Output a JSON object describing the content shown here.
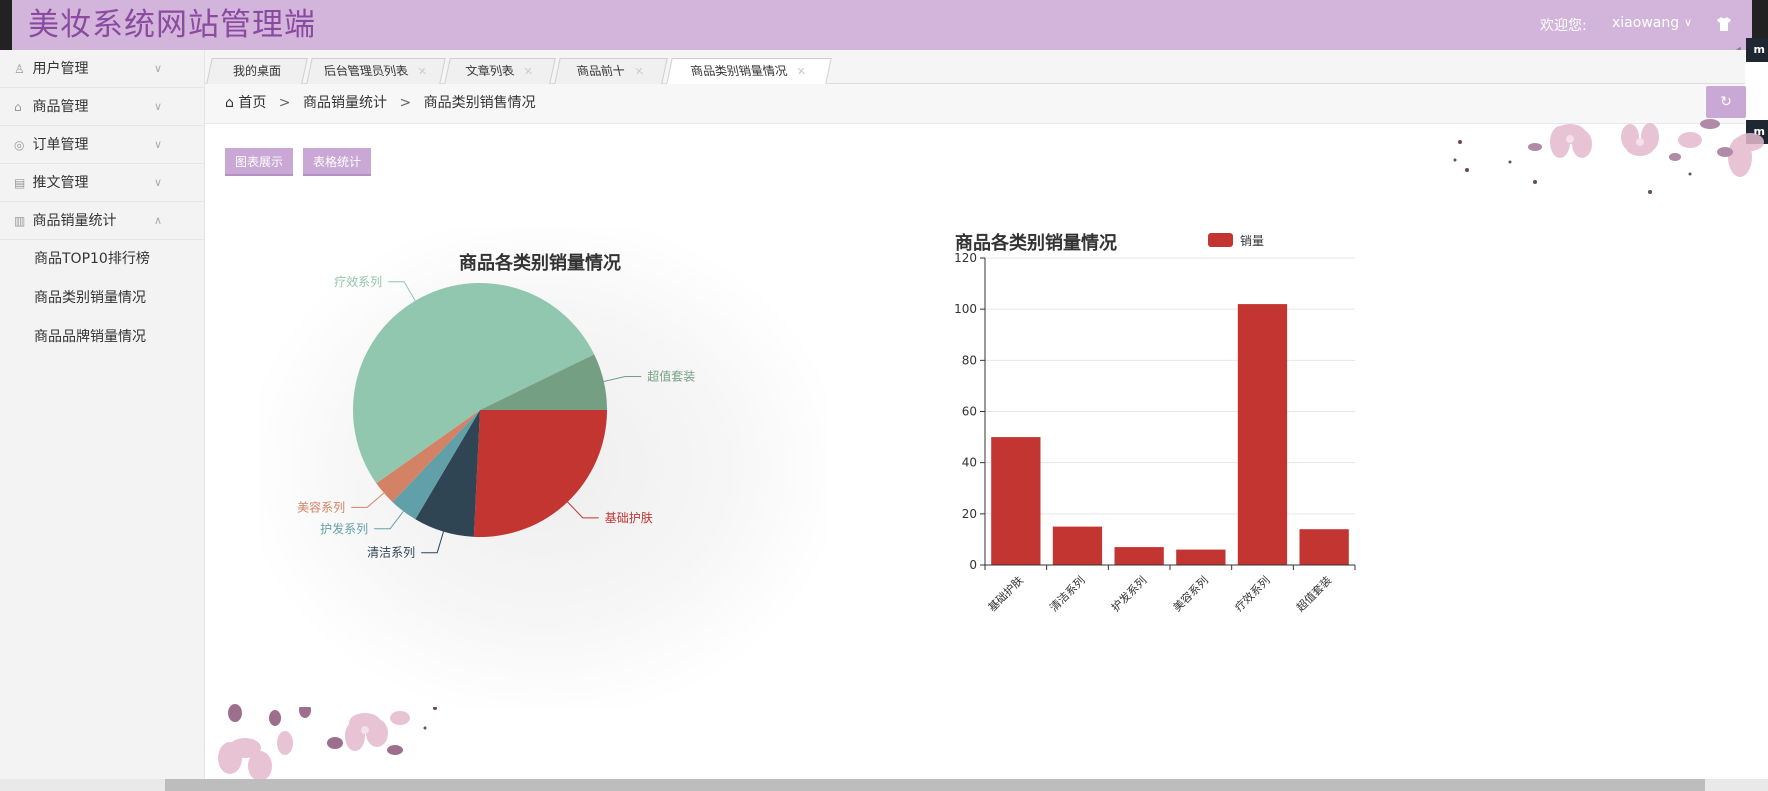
{
  "header": {
    "title": "美妆系统网站管理端",
    "welcome": "欢迎您:",
    "username": "xiaowang"
  },
  "sidebar": {
    "items": [
      {
        "label": "用户管理",
        "icon": "users-icon",
        "expanded": false
      },
      {
        "label": "商品管理",
        "icon": "bag-icon",
        "expanded": false
      },
      {
        "label": "订单管理",
        "icon": "lock-icon",
        "expanded": false
      },
      {
        "label": "推文管理",
        "icon": "doc-icon",
        "expanded": false
      },
      {
        "label": "商品销量统计",
        "icon": "chart-icon",
        "expanded": true,
        "children": [
          "商品TOP10排行榜",
          "商品类别销量情况",
          "商品品牌销量情况"
        ]
      }
    ]
  },
  "tabs": [
    {
      "label": "我的桌面",
      "closable": false,
      "active": false
    },
    {
      "label": "后台管理员列表",
      "closable": true,
      "active": false
    },
    {
      "label": "文章列表",
      "closable": true,
      "active": false
    },
    {
      "label": "商品前十",
      "closable": true,
      "active": false
    },
    {
      "label": "商品类别销量情况",
      "closable": true,
      "active": true
    }
  ],
  "breadcrumb": {
    "home": "首页",
    "level1": "商品销量统计",
    "level2": "商品类别销售情况",
    "separator": ">"
  },
  "buttons": {
    "chart_view": "图表展示",
    "table_view": "表格统计"
  },
  "colors": {
    "header_bg": "#d3b5dc",
    "title": "#8a4aa0",
    "accent": "#caa8d6",
    "bar": "#c23531"
  },
  "chart_data": [
    {
      "type": "pie",
      "title": "商品各类别销量情况",
      "slices": [
        {
          "label": "基础护肤",
          "value": 50,
          "color": "#c23531"
        },
        {
          "label": "清洁系列",
          "value": 15,
          "color": "#2f4554"
        },
        {
          "label": "护发系列",
          "value": 7,
          "color": "#61a0a8"
        },
        {
          "label": "美容系列",
          "value": 6,
          "color": "#d48265"
        },
        {
          "label": "疗效系列",
          "value": 102,
          "color": "#91c7ae"
        },
        {
          "label": "超值套装",
          "value": 14,
          "color": "#749f83"
        }
      ]
    },
    {
      "type": "bar",
      "title": "商品各类别销量情况",
      "legend": "销量",
      "legend_position": "top",
      "categories": [
        "基础护肤",
        "清洁系列",
        "护发系列",
        "美容系列",
        "疗效系列",
        "超值套装"
      ],
      "values": [
        50,
        15,
        7,
        6,
        102,
        14
      ],
      "ylim": [
        0,
        120
      ],
      "yticks": [
        0,
        20,
        40,
        60,
        80,
        100,
        120
      ],
      "grid": true
    }
  ]
}
